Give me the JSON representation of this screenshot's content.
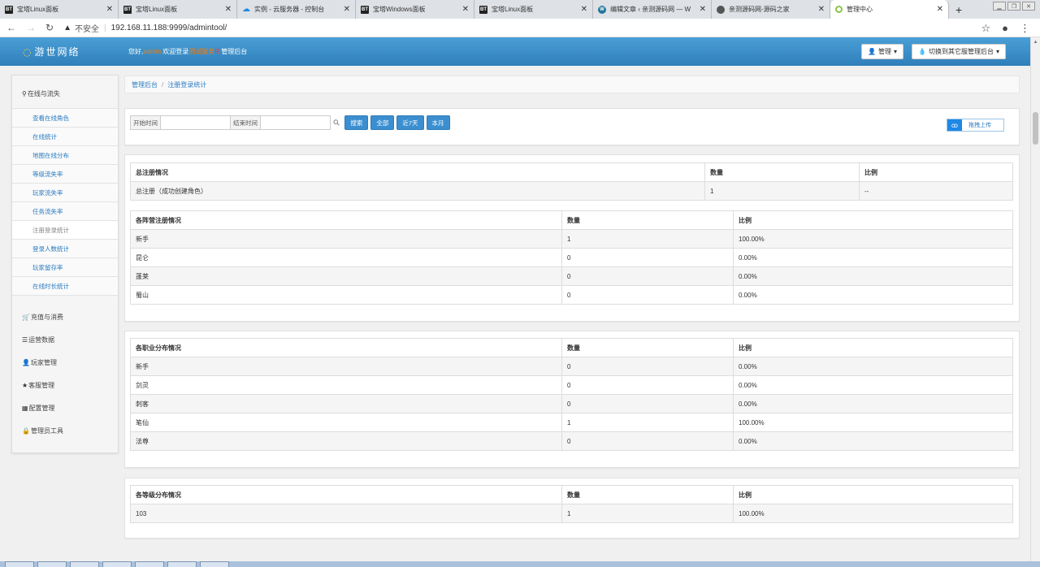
{
  "browser": {
    "tabs": [
      {
        "icon": "bt-icon",
        "badge": "BT",
        "label": "宝塔Linux面板"
      },
      {
        "icon": "bt-icon",
        "badge": "BT",
        "label": "宝塔Linux面板"
      },
      {
        "icon": "cloud-icon",
        "badge": "☁",
        "label": "实例 - 云服务器 - 控制台"
      },
      {
        "icon": "bt-icon",
        "badge": "BT",
        "label": "宝塔Windows面板"
      },
      {
        "icon": "bt-icon",
        "badge": "BT",
        "label": "宝塔Linux面板"
      },
      {
        "icon": "wordpress-icon",
        "badge": "W",
        "label": "编辑文章 ‹ 亲测源码网 — W"
      },
      {
        "icon": "globe-icon",
        "badge": "",
        "label": "亲测源码网-源码之家"
      },
      {
        "icon": "ring-icon",
        "badge": "",
        "label": "管理中心"
      }
    ],
    "new_tab": "+",
    "security": "不安全",
    "url": "192.168.11.188:9999/admintool/"
  },
  "header": {
    "logo": "游世网络",
    "welcome_prefix": "您好,",
    "user": "admin",
    "welcome_mid": "欢迎登录",
    "server": "测试服务",
    "badge": "R",
    "welcome_suffix": "管理后台",
    "manage_btn": "管理",
    "switch_btn": "切换到其它服管理后台"
  },
  "sidebar": {
    "groups": [
      {
        "icon": "pin-icon",
        "glyph": "⚲",
        "label": "在线与流失",
        "items": [
          {
            "label": "查看在线角色",
            "active": false
          },
          {
            "label": "在线统计",
            "active": false
          },
          {
            "label": "地图在线分布",
            "active": false
          },
          {
            "label": "等级流失率",
            "active": false
          },
          {
            "label": "玩家流失率",
            "active": false
          },
          {
            "label": "任务流失率",
            "active": false
          },
          {
            "label": "注册登录统计",
            "active": true
          },
          {
            "label": "登录人数统计",
            "active": false
          },
          {
            "label": "玩家留存率",
            "active": false
          },
          {
            "label": "在线时长统计",
            "active": false
          }
        ]
      },
      {
        "icon": "cart-icon",
        "glyph": "🛒",
        "label": "充值与消费"
      },
      {
        "icon": "list-icon",
        "glyph": "☰",
        "label": "运营数据"
      },
      {
        "icon": "user-icon",
        "glyph": "👤",
        "label": "玩家管理"
      },
      {
        "icon": "star-icon",
        "glyph": "★",
        "label": "客服管理"
      },
      {
        "icon": "config-icon",
        "glyph": "▦",
        "label": "配置管理"
      },
      {
        "icon": "lock-icon",
        "glyph": "🔒",
        "label": "管理员工具"
      }
    ]
  },
  "breadcrumb": {
    "root": "管理后台",
    "current": "注册登录统计"
  },
  "filter": {
    "start_label": "开始时间",
    "end_label": "结束时间",
    "start_value": "",
    "end_value": "",
    "buttons": [
      "搜索",
      "全部",
      "近7天",
      "本月"
    ],
    "upload": "拖拽上传"
  },
  "total_table": {
    "headers": [
      "总注册情况",
      "数量",
      "比例"
    ],
    "rows": [
      [
        "总注册（成功创建角色）",
        "1",
        "--"
      ]
    ]
  },
  "camp_table": {
    "headers": [
      "各阵营注册情况",
      "数量",
      "比例"
    ],
    "rows": [
      [
        "新手",
        "1",
        "100.00%"
      ],
      [
        "昆仑",
        "0",
        "0.00%"
      ],
      [
        "蓬莱",
        "0",
        "0.00%"
      ],
      [
        "蜀山",
        "0",
        "0.00%"
      ]
    ]
  },
  "job_table": {
    "headers": [
      "各职业分布情况",
      "数量",
      "比例"
    ],
    "rows": [
      [
        "新手",
        "0",
        "0.00%"
      ],
      [
        "剑灵",
        "0",
        "0.00%"
      ],
      [
        "刺客",
        "0",
        "0.00%"
      ],
      [
        "笔仙",
        "1",
        "100.00%"
      ],
      [
        "法尊",
        "0",
        "0.00%"
      ]
    ]
  },
  "level_table": {
    "headers": [
      "各等级分布情况",
      "数量",
      "比例"
    ],
    "rows": [
      [
        "103",
        "1",
        "100.00%"
      ]
    ]
  }
}
